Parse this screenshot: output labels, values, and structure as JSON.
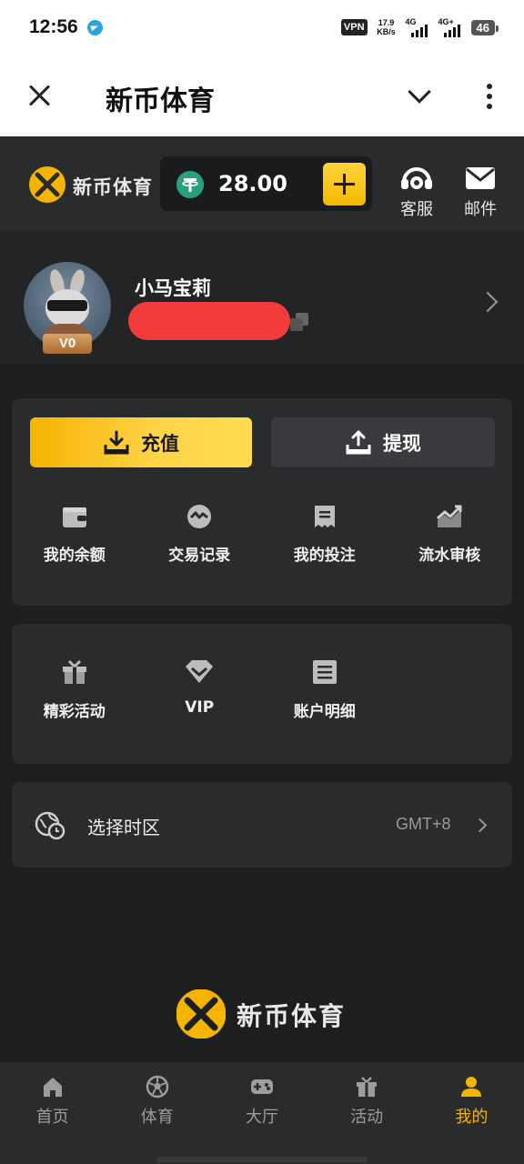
{
  "status_bar": {
    "time": "12:56",
    "vpn": "VPN",
    "speed_value": "17.9",
    "speed_unit": "KB/s",
    "net1": "4G",
    "net2": "4G+",
    "battery": "46"
  },
  "title_bar": {
    "title": "新币体育"
  },
  "header": {
    "brand_name": "新币体育",
    "balance": "28.00",
    "service_label": "客服",
    "mail_label": "邮件"
  },
  "profile": {
    "username": "小马宝莉",
    "vip_level": "V0"
  },
  "actions": {
    "deposit_label": "充值",
    "withdraw_label": "提现"
  },
  "quick_grid": [
    {
      "label": "我的余额",
      "icon": "wallet-icon"
    },
    {
      "label": "交易记录",
      "icon": "exchange-icon"
    },
    {
      "label": "我的投注",
      "icon": "receipt-icon"
    },
    {
      "label": "流水审核",
      "icon": "trend-chart-icon"
    }
  ],
  "more_grid": [
    {
      "label": "精彩活动",
      "icon": "gift-icon"
    },
    {
      "label": "VIP",
      "icon": "diamond-icon"
    },
    {
      "label": "账户明细",
      "icon": "document-list-icon"
    }
  ],
  "timezone": {
    "label": "选择时区",
    "value": "GMT+8"
  },
  "footer": {
    "brand_name": "新币体育"
  },
  "bottom_nav": [
    {
      "label": "首页",
      "icon": "home-icon",
      "active": false
    },
    {
      "label": "体育",
      "icon": "soccer-ball-icon",
      "active": false
    },
    {
      "label": "大厅",
      "icon": "gamepad-icon",
      "active": false
    },
    {
      "label": "活动",
      "icon": "gift-icon",
      "active": false
    },
    {
      "label": "我的",
      "icon": "user-icon",
      "active": true
    }
  ],
  "colors": {
    "accent": "#f5b400",
    "background": "#1d1e20",
    "panel": "#2a2b2d",
    "usdt": "#26a17b"
  }
}
